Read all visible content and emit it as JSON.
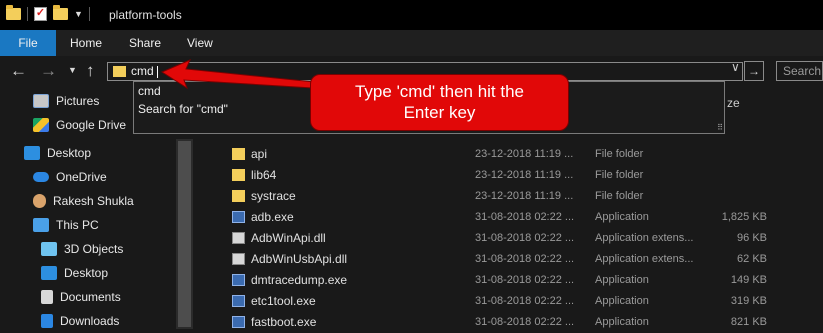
{
  "window": {
    "title": "platform-tools"
  },
  "ribbon": {
    "tabs": [
      "File",
      "Home",
      "Share",
      "View"
    ]
  },
  "address": {
    "value": "cmd",
    "search_placeholder": "Search"
  },
  "autocomplete": {
    "items": [
      "cmd",
      "Search for \"cmd\""
    ]
  },
  "callout": {
    "line1": "Type 'cmd' then hit the",
    "line2": "Enter key"
  },
  "column_headers": {
    "size_fragment": "ze"
  },
  "nav": {
    "items": [
      {
        "label": "Pictures",
        "icon": "pictures-icon"
      },
      {
        "label": "Google Drive",
        "icon": "google-drive-icon"
      },
      {
        "label": "Desktop",
        "icon": "desktop-icon"
      },
      {
        "label": "OneDrive",
        "icon": "onedrive-icon"
      },
      {
        "label": "Rakesh Shukla",
        "icon": "user-icon"
      },
      {
        "label": "This PC",
        "icon": "this-pc-icon"
      },
      {
        "label": "3D Objects",
        "icon": "3d-objects-icon"
      },
      {
        "label": "Desktop",
        "icon": "desktop-icon"
      },
      {
        "label": "Documents",
        "icon": "documents-icon"
      },
      {
        "label": "Downloads",
        "icon": "downloads-icon"
      }
    ]
  },
  "files": [
    {
      "name": "api",
      "date": "23-12-2018 11:19 ...",
      "type": "File folder",
      "size": "",
      "icon": "folder"
    },
    {
      "name": "lib64",
      "date": "23-12-2018 11:19 ...",
      "type": "File folder",
      "size": "",
      "icon": "folder"
    },
    {
      "name": "systrace",
      "date": "23-12-2018 11:19 ...",
      "type": "File folder",
      "size": "",
      "icon": "folder"
    },
    {
      "name": "adb.exe",
      "date": "31-08-2018 02:22 ...",
      "type": "Application",
      "size": "1,825 KB",
      "icon": "app"
    },
    {
      "name": "AdbWinApi.dll",
      "date": "31-08-2018 02:22 ...",
      "type": "Application extens...",
      "size": "96 KB",
      "icon": "dll"
    },
    {
      "name": "AdbWinUsbApi.dll",
      "date": "31-08-2018 02:22 ...",
      "type": "Application extens...",
      "size": "62 KB",
      "icon": "dll"
    },
    {
      "name": "dmtracedump.exe",
      "date": "31-08-2018 02:22 ...",
      "type": "Application",
      "size": "149 KB",
      "icon": "app"
    },
    {
      "name": "etc1tool.exe",
      "date": "31-08-2018 02:22 ...",
      "type": "Application",
      "size": "319 KB",
      "icon": "app"
    },
    {
      "name": "fastboot.exe",
      "date": "31-08-2018 02:22 ...",
      "type": "Application",
      "size": "821 KB",
      "icon": "app"
    }
  ],
  "colors": {
    "accent": "#1a78c2",
    "callout": "#e10808",
    "folder": "#f3ce5b"
  }
}
